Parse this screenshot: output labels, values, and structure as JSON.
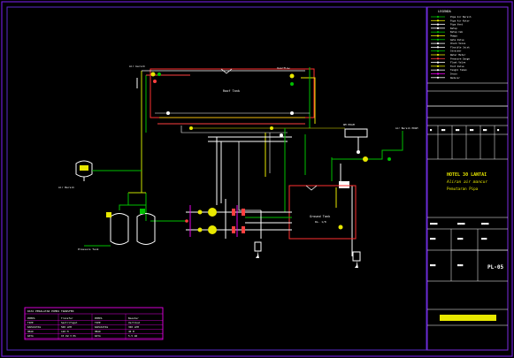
{
  "drawing": {
    "project_block": {
      "line1": "HOTEL 30 LANTAI",
      "line2": "Aliran air mancur",
      "line3": "Pemutaran Pipa"
    },
    "sheet_code": "PL-05",
    "tank_upper": "Roof Tank",
    "tank_lower": "Ground Tank",
    "tank_lower_sub": "Rs. 1/8",
    "legend_title": "LEGENDA",
    "legend_items": [
      "Pipa Air Bersih",
      "Pipa Air Kotor",
      "Pipa Vent",
      "Katup",
      "Katup Cek",
      "Pompa",
      "Gate Valve",
      "Check Valve",
      "Flexible Joint",
      "Strainer",
      "Water Meter",
      "Pressure Gauge",
      "Float Valve",
      "Foot Valve",
      "Tangki Tekan",
      "Drain",
      "Reducer"
    ],
    "spec_table": {
      "title": "DATA PERALATAN POMPA TRANSFER",
      "rows": [
        [
          "POMPA",
          "Transfer",
          "POMPA",
          "Booster"
        ],
        [
          "TIPE",
          "Sentrifugal",
          "TIPE",
          "Vertikal"
        ],
        [
          "KAPASITAS",
          "500 LPM",
          "KAPASITAS",
          "300 LPM"
        ],
        [
          "HEAD",
          "120 M",
          "HEAD",
          "40 M"
        ],
        [
          "DAYA",
          "15 kW 3 Ph",
          "DAYA",
          "5.5 kW"
        ]
      ]
    },
    "labels": {
      "top_left_pipe": "Air bersih",
      "top_right_pipe": "Overflow",
      "left_tank_label": "Air Bersih",
      "left_tank_sub": "Pressure Tank",
      "meter_label": "WM PDAM",
      "right_box_label": "Air Bersih PDAM"
    }
  }
}
